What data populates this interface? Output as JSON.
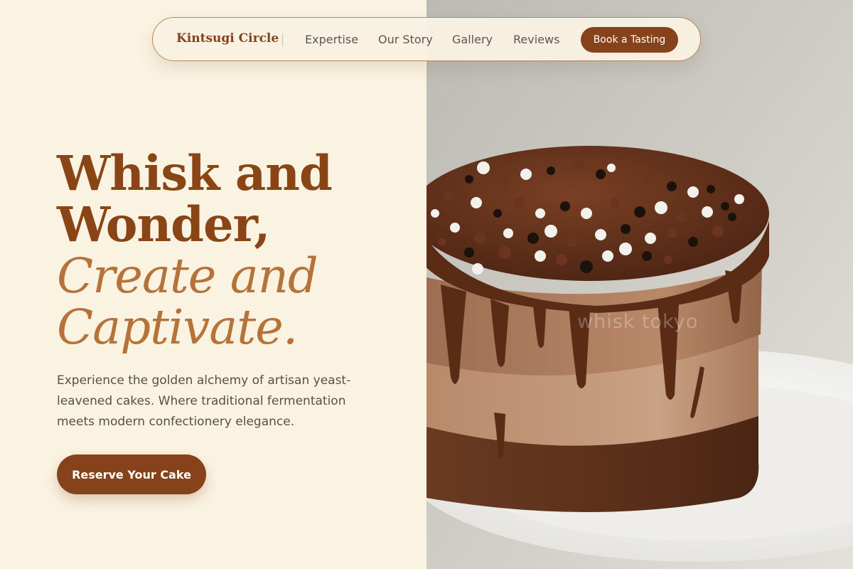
{
  "nav": {
    "brand": "Kintsugi Circle",
    "links": [
      "Expertise",
      "Our Story",
      "Gallery",
      "Reviews"
    ],
    "cta_label": "Book a Tasting"
  },
  "hero": {
    "title_line1": "Whisk and",
    "title_line2": "Wonder,",
    "title_line3": "Create and",
    "title_line4": "Captivate.",
    "description": "Experience the golden alchemy of artisan yeast-leavened cakes. Where traditional fermentation meets modern confectionery elegance.",
    "cta_label": "Reserve Your Cake",
    "image_watermark": "whisk tokyo"
  },
  "colors": {
    "brand_brown": "#86421a",
    "accent_caramel": "#b5733a",
    "background_cream": "#fbf3e2"
  },
  "icons": {
    "hero_image": "chocolate-drip-cake-photo"
  }
}
